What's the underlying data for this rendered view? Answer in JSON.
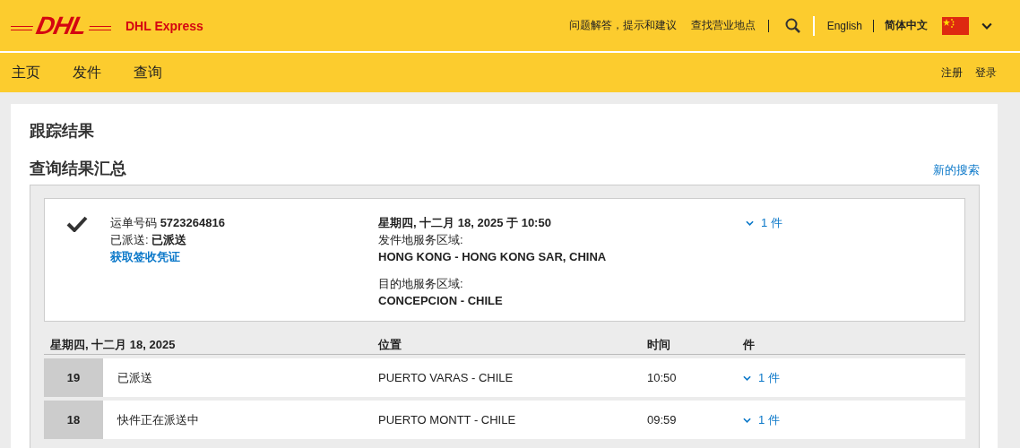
{
  "header": {
    "logo_text": "DHL",
    "brand": "DHL Express",
    "links": [
      "问题解答，提示和建议",
      "查找营业地点"
    ],
    "languages": [
      {
        "label": "English",
        "selected": false
      },
      {
        "label": "简体中文",
        "selected": true
      }
    ]
  },
  "nav": {
    "items": [
      "主页",
      "发件",
      "查询"
    ],
    "account_links": [
      "注册",
      "登录"
    ]
  },
  "page_title": "跟踪结果",
  "summary": {
    "title": "查询结果汇总",
    "new_search": "新的搜索",
    "shipment": {
      "delivered": true,
      "waybill": "运单号码 **5723264816**",
      "status": "已派送: **已派送**",
      "proof_link": "获取签收凭证",
      "date": "星期四, 十二月 18, 2025 于 10:50",
      "origin_label": "发件地服务区域:",
      "origin": "HONG KONG - HONG KONG SAR, CHINA",
      "destination_label": "目的地服务区域:",
      "destination": "CONCEPCION - CHILE",
      "pieces": "1 件"
    }
  },
  "events": {
    "columns": [
      "星期四, 十二月 18, 2025",
      "位置",
      "时间",
      "件"
    ],
    "rows": [
      {
        "day": "19",
        "status": "已派送",
        "location": "PUERTO VARAS - CHILE",
        "time": "10:50",
        "pieces": "1 件"
      },
      {
        "day": "18",
        "status": "快件正在派送中",
        "location": "PUERTO MONTT - CHILE",
        "time": "09:59",
        "pieces": "1 件"
      }
    ]
  }
}
